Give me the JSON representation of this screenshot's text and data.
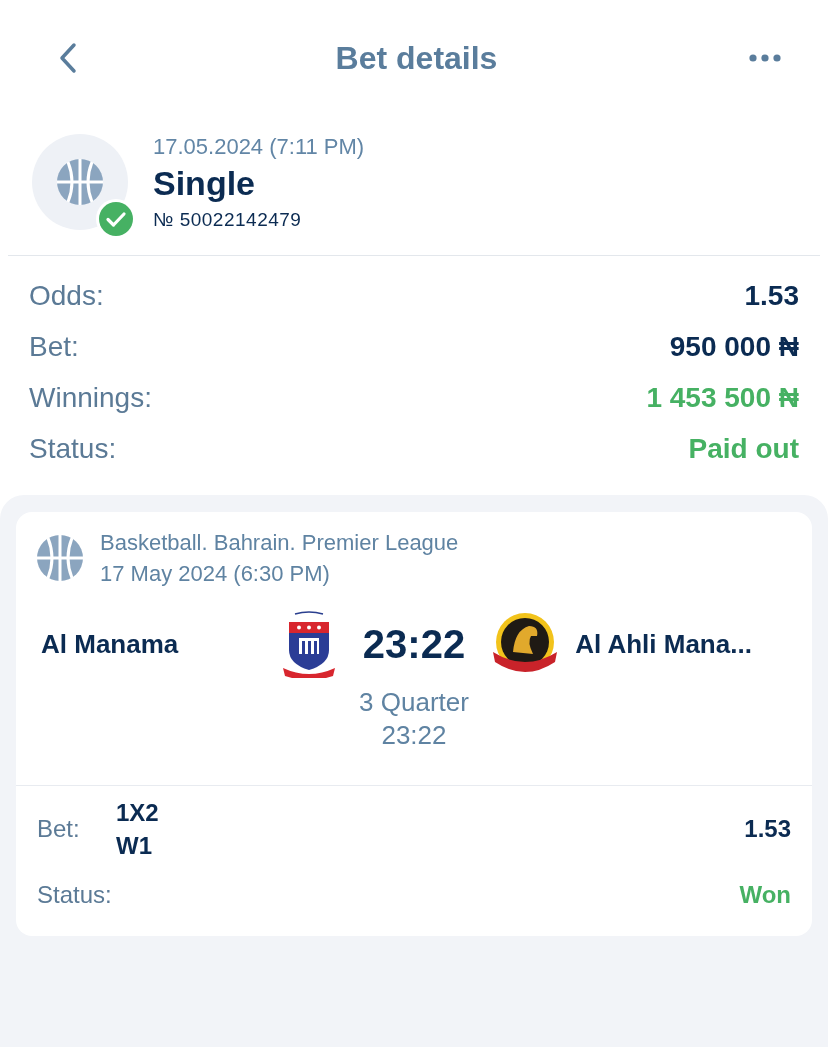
{
  "header": {
    "title": "Bet details"
  },
  "bet": {
    "date": "17.05.2024 (7:11 PM)",
    "type": "Single",
    "number": "№ 50022142479",
    "settled": true
  },
  "summary": [
    {
      "label": "Odds:",
      "value": "1.53",
      "positive": false
    },
    {
      "label": "Bet:",
      "value": "950 000 ₦",
      "positive": false
    },
    {
      "label": "Winnings:",
      "value": "1 453 500 ₦",
      "positive": true
    },
    {
      "label": "Status:",
      "value": "Paid out",
      "positive": true
    }
  ],
  "event": {
    "league": "Basketball. Bahrain. Premier League",
    "date": "17 May 2024 (6:30 PM)",
    "home": "Al Manama",
    "score": "23:22",
    "away": "Al Ahli Mana...",
    "period": "3 Quarter",
    "time": "23:22"
  },
  "selection": {
    "label": "Bet:",
    "market": "1X2",
    "outcome": "W1",
    "odds": "1.53",
    "status_label": "Status:",
    "status": "Won",
    "positive": true
  }
}
